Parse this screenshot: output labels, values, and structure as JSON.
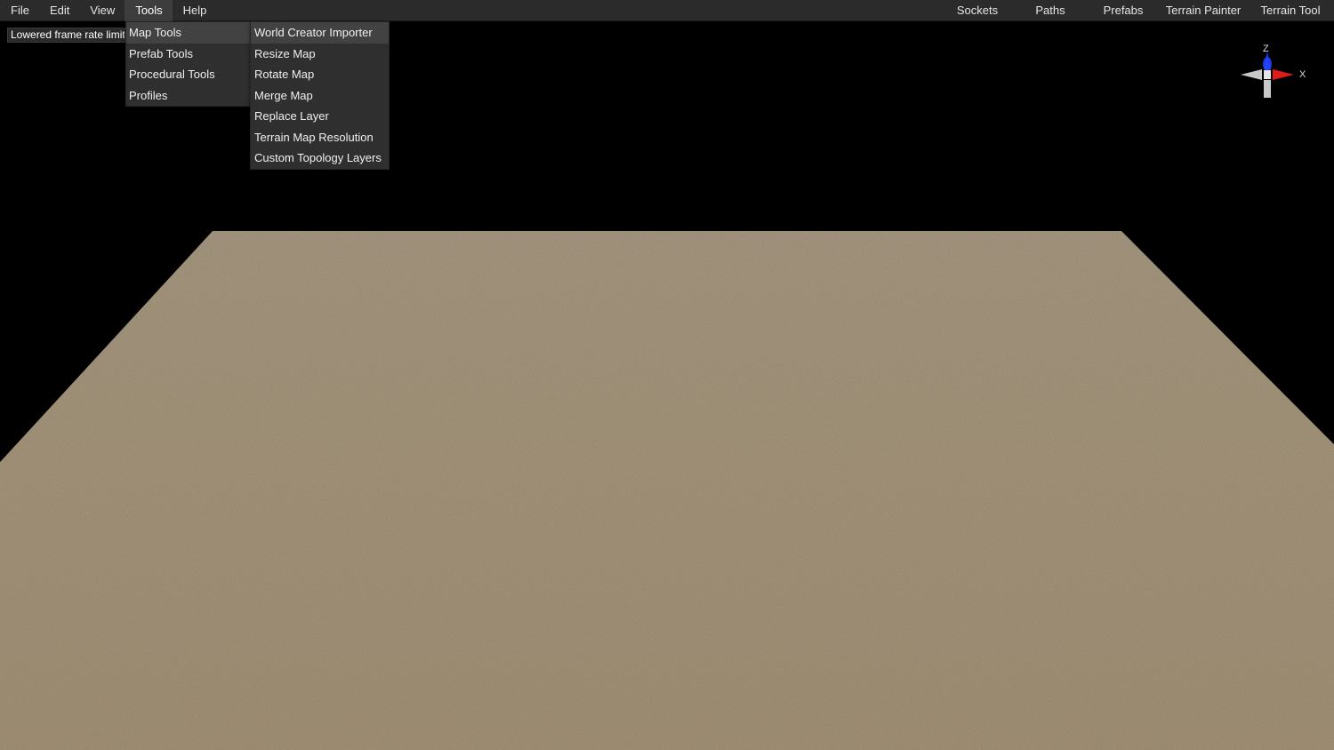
{
  "menubar": {
    "left": [
      "File",
      "Edit",
      "View",
      "Tools",
      "Help"
    ],
    "active": "Tools",
    "right": [
      "Sockets",
      "Paths",
      "Prefabs",
      "Terrain Painter",
      "Terrain Tool"
    ]
  },
  "notice": {
    "text": "Lowered frame rate limit"
  },
  "tools_menu": {
    "items": [
      "Map Tools",
      "Prefab Tools",
      "Procedural Tools",
      "Profiles"
    ],
    "highlighted": "Map Tools"
  },
  "map_tools_submenu": {
    "items": [
      "World Creator Importer",
      "Resize Map",
      "Rotate Map",
      "Merge Map",
      "Replace Layer",
      "Terrain Map Resolution",
      "Custom Topology Layers"
    ],
    "highlighted": "World Creator Importer"
  },
  "gizmo": {
    "labels": {
      "z": "Z",
      "x": "X"
    },
    "colors": {
      "z": "#1e3cff",
      "x": "#e01b1b",
      "neutral": "#c8c8c8"
    }
  },
  "viewport": {
    "background": "#000000",
    "terrain_color": "#a8977b"
  }
}
